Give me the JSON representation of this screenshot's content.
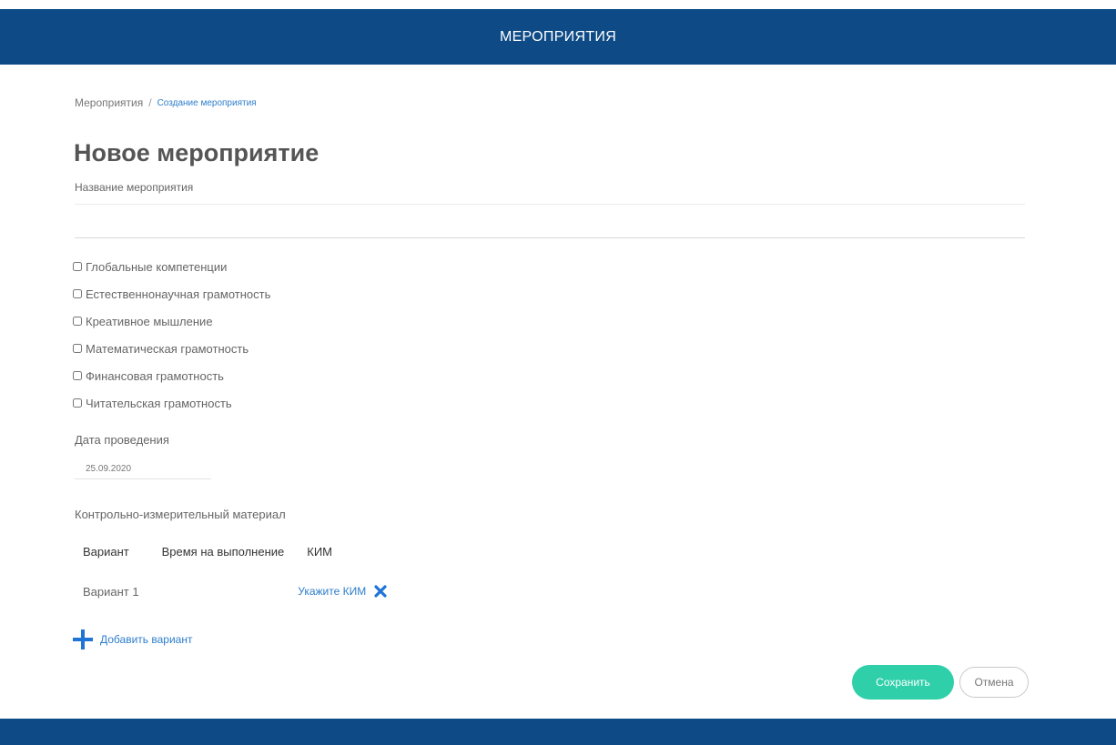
{
  "header": {
    "title": "МЕРОПРИЯТИЯ"
  },
  "breadcrumb": {
    "root": "Мероприятия",
    "separator": "/",
    "current": "Создание мероприятия"
  },
  "page": {
    "title": "Новое мероприятие"
  },
  "form": {
    "name_label": "Название мероприятия",
    "name_value": "",
    "competencies": [
      {
        "label": "Глобальные компетенции",
        "checked": false
      },
      {
        "label": "Естественнонаучная грамотность",
        "checked": false
      },
      {
        "label": "Креативное мышление",
        "checked": false
      },
      {
        "label": "Математическая грамотность",
        "checked": false
      },
      {
        "label": "Финансовая грамотность",
        "checked": false
      },
      {
        "label": "Читательская грамотность",
        "checked": false
      }
    ],
    "date_label": "Дата проведения",
    "date_value": "25.09.2020",
    "kim_label": "Контрольно-измерительный материал",
    "kim_table": {
      "headers": [
        "Вариант",
        "Время на выполнение",
        "КИМ"
      ],
      "rows": [
        {
          "variant": "Вариант 1",
          "time": "",
          "kim_link": "Укажите КИМ"
        }
      ]
    },
    "add_variant_label": "Добавить вариант",
    "save_label": "Сохранить",
    "cancel_label": "Отмена"
  },
  "icons": {
    "remove": "close-icon",
    "add": "plus-icon"
  },
  "colors": {
    "header_bg": "#0e4a86",
    "accent": "#2d7ecb",
    "save_bg": "#2ecfa9"
  }
}
